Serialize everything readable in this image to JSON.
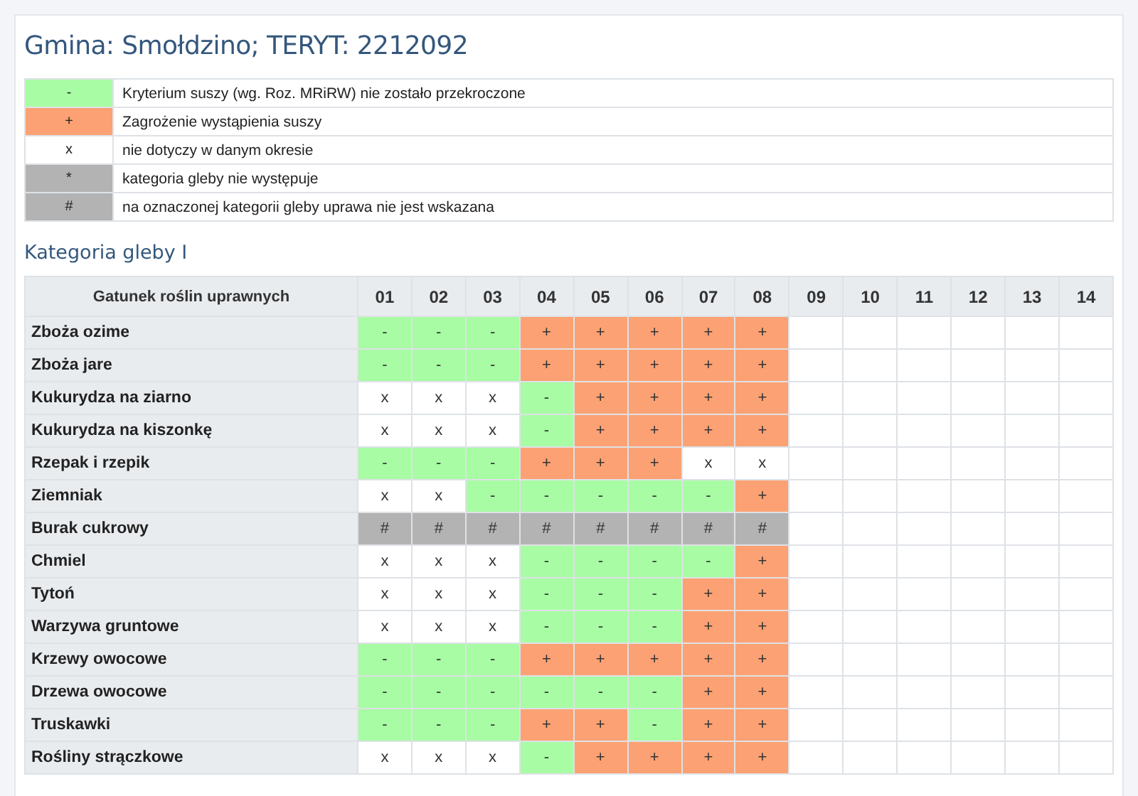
{
  "title": "Gmina: Smołdzino; TERYT: 2212092",
  "legend": [
    {
      "symbol": "-",
      "kind": "ok",
      "text": "Kryterium suszy (wg. Roz. MRiRW) nie zostało przekroczone"
    },
    {
      "symbol": "+",
      "kind": "risk",
      "text": "Zagrożenie wystąpienia suszy"
    },
    {
      "symbol": "x",
      "kind": "na",
      "text": "nie dotyczy w danym okresie"
    },
    {
      "symbol": "*",
      "kind": "absent",
      "text": "kategoria gleby nie występuje"
    },
    {
      "symbol": "#",
      "kind": "excluded",
      "text": "na oznaczonej kategorii gleby uprawa nie jest wskazana"
    }
  ],
  "section_title": "Kategoria gleby I",
  "table": {
    "columns": [
      "Gatunek roślin uprawnych",
      "01",
      "02",
      "03",
      "04",
      "05",
      "06",
      "07",
      "08",
      "09",
      "10",
      "11",
      "12",
      "13",
      "14"
    ],
    "rows": [
      {
        "cells": [
          {
            "text": "Zboża ozime",
            "kind": "crop"
          },
          {
            "text": "-",
            "kind": "ok"
          },
          {
            "text": "-",
            "kind": "ok"
          },
          {
            "text": "-",
            "kind": "ok"
          },
          {
            "text": "+",
            "kind": "risk"
          },
          {
            "text": "+",
            "kind": "risk"
          },
          {
            "text": "+",
            "kind": "risk"
          },
          {
            "text": "+",
            "kind": "risk"
          },
          {
            "text": "+",
            "kind": "risk"
          }
        ]
      },
      {
        "cells": [
          {
            "text": "Zboża jare",
            "kind": "crop"
          },
          {
            "text": "-",
            "kind": "ok"
          },
          {
            "text": "-",
            "kind": "ok"
          },
          {
            "text": "-",
            "kind": "ok"
          },
          {
            "text": "+",
            "kind": "risk"
          },
          {
            "text": "+",
            "kind": "risk"
          },
          {
            "text": "+",
            "kind": "risk"
          },
          {
            "text": "+",
            "kind": "risk"
          },
          {
            "text": "+",
            "kind": "risk"
          }
        ]
      },
      {
        "cells": [
          {
            "text": "Kukurydza na ziarno",
            "kind": "crop"
          },
          {
            "text": "x",
            "kind": "na"
          },
          {
            "text": "x",
            "kind": "na"
          },
          {
            "text": "x",
            "kind": "na"
          },
          {
            "text": "-",
            "kind": "ok"
          },
          {
            "text": "+",
            "kind": "risk"
          },
          {
            "text": "+",
            "kind": "risk"
          },
          {
            "text": "+",
            "kind": "risk"
          },
          {
            "text": "+",
            "kind": "risk"
          }
        ]
      },
      {
        "cells": [
          {
            "text": "Kukurydza na kiszonkę",
            "kind": "crop"
          },
          {
            "text": "x",
            "kind": "na"
          },
          {
            "text": "x",
            "kind": "na"
          },
          {
            "text": "x",
            "kind": "na"
          },
          {
            "text": "-",
            "kind": "ok"
          },
          {
            "text": "+",
            "kind": "risk"
          },
          {
            "text": "+",
            "kind": "risk"
          },
          {
            "text": "+",
            "kind": "risk"
          },
          {
            "text": "+",
            "kind": "risk"
          }
        ]
      },
      {
        "cells": [
          {
            "text": "Rzepak i rzepik",
            "kind": "crop"
          },
          {
            "text": "-",
            "kind": "ok"
          },
          {
            "text": "-",
            "kind": "ok"
          },
          {
            "text": "-",
            "kind": "ok"
          },
          {
            "text": "+",
            "kind": "risk"
          },
          {
            "text": "+",
            "kind": "risk"
          },
          {
            "text": "+",
            "kind": "risk"
          },
          {
            "text": "x",
            "kind": "na"
          },
          {
            "text": "x",
            "kind": "na"
          }
        ]
      },
      {
        "cells": [
          {
            "text": "Ziemniak",
            "kind": "crop"
          },
          {
            "text": "x",
            "kind": "na"
          },
          {
            "text": "x",
            "kind": "na"
          },
          {
            "text": "-",
            "kind": "ok"
          },
          {
            "text": "-",
            "kind": "ok"
          },
          {
            "text": "-",
            "kind": "ok"
          },
          {
            "text": "-",
            "kind": "ok"
          },
          {
            "text": "-",
            "kind": "ok"
          },
          {
            "text": "+",
            "kind": "risk"
          }
        ]
      },
      {
        "cells": [
          {
            "text": "Burak cukrowy",
            "kind": "crop"
          },
          {
            "text": "#",
            "kind": "excluded"
          },
          {
            "text": "#",
            "kind": "excluded"
          },
          {
            "text": "#",
            "kind": "excluded"
          },
          {
            "text": "#",
            "kind": "excluded"
          },
          {
            "text": "#",
            "kind": "excluded"
          },
          {
            "text": "#",
            "kind": "excluded"
          },
          {
            "text": "#",
            "kind": "excluded"
          },
          {
            "text": "#",
            "kind": "excluded"
          }
        ]
      },
      {
        "cells": [
          {
            "text": "Chmiel",
            "kind": "crop"
          },
          {
            "text": "x",
            "kind": "na"
          },
          {
            "text": "x",
            "kind": "na"
          },
          {
            "text": "x",
            "kind": "na"
          },
          {
            "text": "-",
            "kind": "ok"
          },
          {
            "text": "-",
            "kind": "ok"
          },
          {
            "text": "-",
            "kind": "ok"
          },
          {
            "text": "-",
            "kind": "ok"
          },
          {
            "text": "+",
            "kind": "risk"
          }
        ]
      },
      {
        "cells": [
          {
            "text": "Tytoń",
            "kind": "crop"
          },
          {
            "text": "x",
            "kind": "na"
          },
          {
            "text": "x",
            "kind": "na"
          },
          {
            "text": "x",
            "kind": "na"
          },
          {
            "text": "-",
            "kind": "ok"
          },
          {
            "text": "-",
            "kind": "ok"
          },
          {
            "text": "-",
            "kind": "ok"
          },
          {
            "text": "+",
            "kind": "risk"
          },
          {
            "text": "+",
            "kind": "risk"
          }
        ]
      },
      {
        "cells": [
          {
            "text": "Warzywa gruntowe",
            "kind": "crop"
          },
          {
            "text": "x",
            "kind": "na"
          },
          {
            "text": "x",
            "kind": "na"
          },
          {
            "text": "x",
            "kind": "na"
          },
          {
            "text": "-",
            "kind": "ok"
          },
          {
            "text": "-",
            "kind": "ok"
          },
          {
            "text": "-",
            "kind": "ok"
          },
          {
            "text": "+",
            "kind": "risk"
          },
          {
            "text": "+",
            "kind": "risk"
          }
        ]
      },
      {
        "cells": [
          {
            "text": "Krzewy owocowe",
            "kind": "crop"
          },
          {
            "text": "-",
            "kind": "ok"
          },
          {
            "text": "-",
            "kind": "ok"
          },
          {
            "text": "-",
            "kind": "ok"
          },
          {
            "text": "+",
            "kind": "risk"
          },
          {
            "text": "+",
            "kind": "risk"
          },
          {
            "text": "+",
            "kind": "risk"
          },
          {
            "text": "+",
            "kind": "risk"
          },
          {
            "text": "+",
            "kind": "risk"
          }
        ]
      },
      {
        "cells": [
          {
            "text": "Drzewa owocowe",
            "kind": "crop"
          },
          {
            "text": "-",
            "kind": "ok"
          },
          {
            "text": "-",
            "kind": "ok"
          },
          {
            "text": "-",
            "kind": "ok"
          },
          {
            "text": "-",
            "kind": "ok"
          },
          {
            "text": "-",
            "kind": "ok"
          },
          {
            "text": "-",
            "kind": "ok"
          },
          {
            "text": "+",
            "kind": "risk"
          },
          {
            "text": "+",
            "kind": "risk"
          }
        ]
      },
      {
        "cells": [
          {
            "text": "Truskawki",
            "kind": "crop"
          },
          {
            "text": "-",
            "kind": "ok"
          },
          {
            "text": "-",
            "kind": "ok"
          },
          {
            "text": "-",
            "kind": "ok"
          },
          {
            "text": "+",
            "kind": "risk"
          },
          {
            "text": "+",
            "kind": "risk"
          },
          {
            "text": "-",
            "kind": "ok"
          },
          {
            "text": "+",
            "kind": "risk"
          },
          {
            "text": "+",
            "kind": "risk"
          }
        ]
      },
      {
        "cells": [
          {
            "text": "Rośliny strączkowe",
            "kind": "crop"
          },
          {
            "text": "x",
            "kind": "na"
          },
          {
            "text": "x",
            "kind": "na"
          },
          {
            "text": "x",
            "kind": "na"
          },
          {
            "text": "-",
            "kind": "ok"
          },
          {
            "text": "+",
            "kind": "risk"
          },
          {
            "text": "+",
            "kind": "risk"
          },
          {
            "text": "+",
            "kind": "risk"
          },
          {
            "text": "+",
            "kind": "risk"
          }
        ]
      }
    ]
  }
}
